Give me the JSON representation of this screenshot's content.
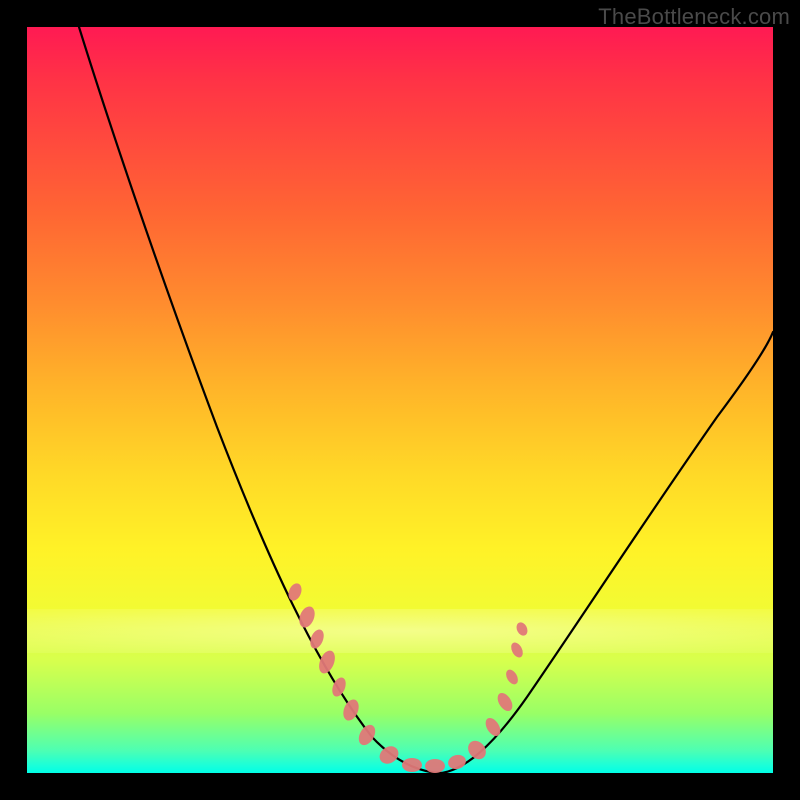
{
  "watermark": "TheBottleneck.com",
  "chart_data": {
    "type": "line",
    "title": "",
    "xlabel": "",
    "ylabel": "",
    "xlim": [
      0,
      100
    ],
    "ylim": [
      0,
      100
    ],
    "grid": false,
    "legend": false,
    "note": "No axis ticks or numeric labels are rendered in the image; values below are positional estimates in percent of plot area.",
    "series": [
      {
        "name": "left-falling-curve",
        "x": [
          7,
          10,
          14,
          18,
          22,
          26,
          30,
          34,
          38,
          42,
          46,
          50,
          53,
          55
        ],
        "y": [
          100,
          92,
          83,
          73,
          63,
          53,
          44,
          35,
          27,
          19,
          12,
          6,
          2,
          0
        ]
      },
      {
        "name": "right-rising-curve",
        "x": [
          55,
          58,
          62,
          66,
          70,
          74,
          78,
          82,
          86,
          90,
          94,
          98,
          100
        ],
        "y": [
          0,
          2,
          5,
          9,
          14,
          20,
          26,
          32,
          38,
          44,
          50,
          56,
          59
        ]
      }
    ],
    "markers": {
      "description": "Small salmon elliptical clusters near the curve trough and lower slopes",
      "color": "#e07878",
      "points": [
        {
          "x": 35,
          "y": 24
        },
        {
          "x": 37,
          "y": 20
        },
        {
          "x": 38.5,
          "y": 17
        },
        {
          "x": 40,
          "y": 14
        },
        {
          "x": 41.5,
          "y": 11
        },
        {
          "x": 43,
          "y": 8
        },
        {
          "x": 45,
          "y": 5
        },
        {
          "x": 48,
          "y": 2
        },
        {
          "x": 50,
          "y": 1
        },
        {
          "x": 52,
          "y": 1
        },
        {
          "x": 54,
          "y": 1
        },
        {
          "x": 56,
          "y": 2
        },
        {
          "x": 59,
          "y": 4
        },
        {
          "x": 62,
          "y": 9
        },
        {
          "x": 63,
          "y": 12
        },
        {
          "x": 64,
          "y": 17
        },
        {
          "x": 65,
          "y": 19
        }
      ]
    },
    "background_gradient": {
      "type": "vertical",
      "stops": [
        {
          "pos": 0,
          "color": "#ff1a53"
        },
        {
          "pos": 0.5,
          "color": "#ffcc27"
        },
        {
          "pos": 0.85,
          "color": "#d7ff4d"
        },
        {
          "pos": 1.0,
          "color": "#00ffe6"
        }
      ]
    }
  }
}
